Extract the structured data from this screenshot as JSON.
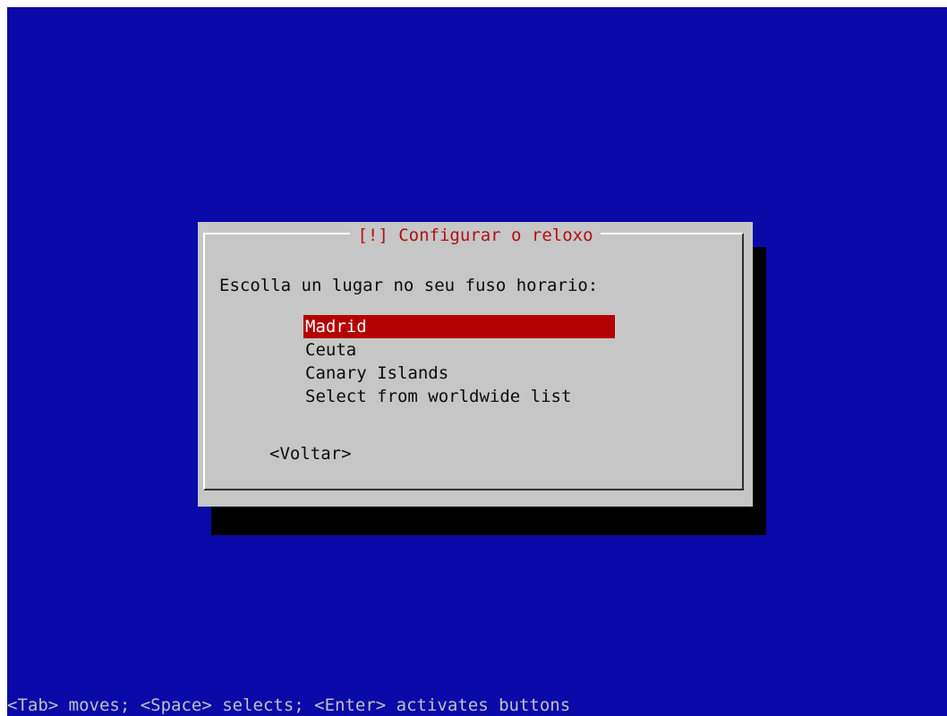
{
  "dialog": {
    "title": "[!] Configurar o reloxo",
    "prompt": "Escolla un lugar no seu fuso horario:",
    "options": [
      "Madrid",
      "Ceuta",
      "Canary Islands",
      "Select from worldwide list"
    ],
    "selected_option": "Madrid",
    "back_button": "<Voltar>"
  },
  "status_bar": {
    "help_text": "<Tab> moves; <Space> selects; <Enter> activates buttons"
  },
  "colors": {
    "background": "#0a0aa8",
    "dialog": "#c6c6c6",
    "highlight": "#b40000",
    "title": "#b01010"
  }
}
